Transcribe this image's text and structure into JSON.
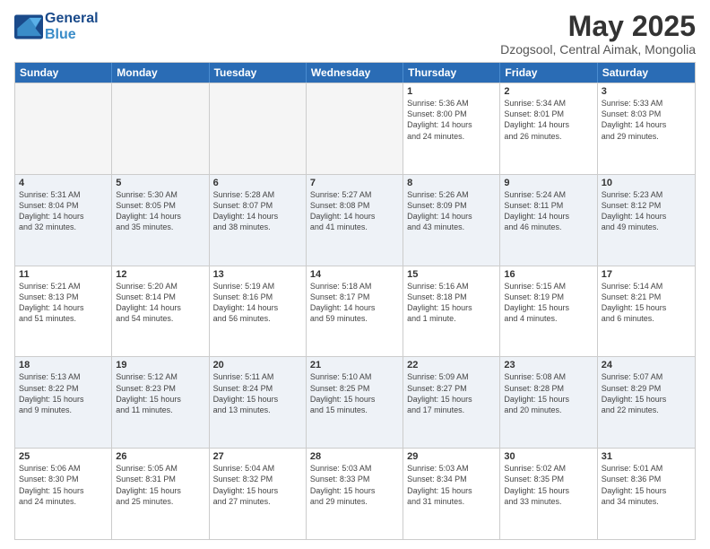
{
  "logo": {
    "line1": "General",
    "line2": "Blue"
  },
  "title": "May 2025",
  "location": "Dzogsool, Central Aimak, Mongolia",
  "days_of_week": [
    "Sunday",
    "Monday",
    "Tuesday",
    "Wednesday",
    "Thursday",
    "Friday",
    "Saturday"
  ],
  "weeks": [
    [
      {
        "day": "",
        "info": ""
      },
      {
        "day": "",
        "info": ""
      },
      {
        "day": "",
        "info": ""
      },
      {
        "day": "",
        "info": ""
      },
      {
        "day": "1",
        "info": "Sunrise: 5:36 AM\nSunset: 8:00 PM\nDaylight: 14 hours\nand 24 minutes."
      },
      {
        "day": "2",
        "info": "Sunrise: 5:34 AM\nSunset: 8:01 PM\nDaylight: 14 hours\nand 26 minutes."
      },
      {
        "day": "3",
        "info": "Sunrise: 5:33 AM\nSunset: 8:03 PM\nDaylight: 14 hours\nand 29 minutes."
      }
    ],
    [
      {
        "day": "4",
        "info": "Sunrise: 5:31 AM\nSunset: 8:04 PM\nDaylight: 14 hours\nand 32 minutes."
      },
      {
        "day": "5",
        "info": "Sunrise: 5:30 AM\nSunset: 8:05 PM\nDaylight: 14 hours\nand 35 minutes."
      },
      {
        "day": "6",
        "info": "Sunrise: 5:28 AM\nSunset: 8:07 PM\nDaylight: 14 hours\nand 38 minutes."
      },
      {
        "day": "7",
        "info": "Sunrise: 5:27 AM\nSunset: 8:08 PM\nDaylight: 14 hours\nand 41 minutes."
      },
      {
        "day": "8",
        "info": "Sunrise: 5:26 AM\nSunset: 8:09 PM\nDaylight: 14 hours\nand 43 minutes."
      },
      {
        "day": "9",
        "info": "Sunrise: 5:24 AM\nSunset: 8:11 PM\nDaylight: 14 hours\nand 46 minutes."
      },
      {
        "day": "10",
        "info": "Sunrise: 5:23 AM\nSunset: 8:12 PM\nDaylight: 14 hours\nand 49 minutes."
      }
    ],
    [
      {
        "day": "11",
        "info": "Sunrise: 5:21 AM\nSunset: 8:13 PM\nDaylight: 14 hours\nand 51 minutes."
      },
      {
        "day": "12",
        "info": "Sunrise: 5:20 AM\nSunset: 8:14 PM\nDaylight: 14 hours\nand 54 minutes."
      },
      {
        "day": "13",
        "info": "Sunrise: 5:19 AM\nSunset: 8:16 PM\nDaylight: 14 hours\nand 56 minutes."
      },
      {
        "day": "14",
        "info": "Sunrise: 5:18 AM\nSunset: 8:17 PM\nDaylight: 14 hours\nand 59 minutes."
      },
      {
        "day": "15",
        "info": "Sunrise: 5:16 AM\nSunset: 8:18 PM\nDaylight: 15 hours\nand 1 minute."
      },
      {
        "day": "16",
        "info": "Sunrise: 5:15 AM\nSunset: 8:19 PM\nDaylight: 15 hours\nand 4 minutes."
      },
      {
        "day": "17",
        "info": "Sunrise: 5:14 AM\nSunset: 8:21 PM\nDaylight: 15 hours\nand 6 minutes."
      }
    ],
    [
      {
        "day": "18",
        "info": "Sunrise: 5:13 AM\nSunset: 8:22 PM\nDaylight: 15 hours\nand 9 minutes."
      },
      {
        "day": "19",
        "info": "Sunrise: 5:12 AM\nSunset: 8:23 PM\nDaylight: 15 hours\nand 11 minutes."
      },
      {
        "day": "20",
        "info": "Sunrise: 5:11 AM\nSunset: 8:24 PM\nDaylight: 15 hours\nand 13 minutes."
      },
      {
        "day": "21",
        "info": "Sunrise: 5:10 AM\nSunset: 8:25 PM\nDaylight: 15 hours\nand 15 minutes."
      },
      {
        "day": "22",
        "info": "Sunrise: 5:09 AM\nSunset: 8:27 PM\nDaylight: 15 hours\nand 17 minutes."
      },
      {
        "day": "23",
        "info": "Sunrise: 5:08 AM\nSunset: 8:28 PM\nDaylight: 15 hours\nand 20 minutes."
      },
      {
        "day": "24",
        "info": "Sunrise: 5:07 AM\nSunset: 8:29 PM\nDaylight: 15 hours\nand 22 minutes."
      }
    ],
    [
      {
        "day": "25",
        "info": "Sunrise: 5:06 AM\nSunset: 8:30 PM\nDaylight: 15 hours\nand 24 minutes."
      },
      {
        "day": "26",
        "info": "Sunrise: 5:05 AM\nSunset: 8:31 PM\nDaylight: 15 hours\nand 25 minutes."
      },
      {
        "day": "27",
        "info": "Sunrise: 5:04 AM\nSunset: 8:32 PM\nDaylight: 15 hours\nand 27 minutes."
      },
      {
        "day": "28",
        "info": "Sunrise: 5:03 AM\nSunset: 8:33 PM\nDaylight: 15 hours\nand 29 minutes."
      },
      {
        "day": "29",
        "info": "Sunrise: 5:03 AM\nSunset: 8:34 PM\nDaylight: 15 hours\nand 31 minutes."
      },
      {
        "day": "30",
        "info": "Sunrise: 5:02 AM\nSunset: 8:35 PM\nDaylight: 15 hours\nand 33 minutes."
      },
      {
        "day": "31",
        "info": "Sunrise: 5:01 AM\nSunset: 8:36 PM\nDaylight: 15 hours\nand 34 minutes."
      }
    ]
  ]
}
